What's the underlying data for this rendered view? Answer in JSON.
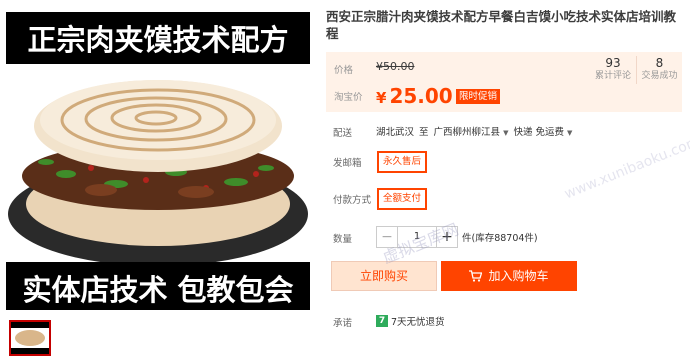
{
  "image": {
    "banner_top": "正宗肉夹馍技术配方",
    "banner_bottom": "实体店技术 包教包会"
  },
  "product": {
    "title": "西安正宗腊汁肉夹馍技术配方早餐白吉馍小吃技术实体店培训教程"
  },
  "price": {
    "orig_label": "价格",
    "orig_value": "¥50.00",
    "current_label": "淘宝价",
    "currency": "¥",
    "current_value": "25.00",
    "promo_badge": "限时促销",
    "stats": [
      {
        "number": "93",
        "label": "累计评论"
      },
      {
        "number": "8",
        "label": "交易成功"
      }
    ]
  },
  "shipping": {
    "label": "配送",
    "from": "湖北武汉",
    "to_prefix": "至",
    "destination": "广西柳州柳江县",
    "method": "快递 免运费"
  },
  "options": {
    "shelf_label": "发邮箱",
    "shelf_value": "永久售后",
    "payment_label": "付款方式",
    "payment_value": "全额支付"
  },
  "quantity": {
    "label": "数量",
    "value": "1",
    "minus": "−",
    "plus": "+",
    "stock_text": "件(库存88704件)"
  },
  "actions": {
    "buy_now": "立即购买",
    "add_to_cart": "加入购物车"
  },
  "promise": {
    "label": "承诺",
    "icon_text": "7",
    "text": "7天无忧退货"
  },
  "watermark": {
    "text_cn": "虚拟宝库网",
    "text_url": "www.xunibaoku.com"
  },
  "colors": {
    "accent": "#ff4400",
    "price_bg": "#fff2e8",
    "promise_green": "#2eab5b"
  }
}
